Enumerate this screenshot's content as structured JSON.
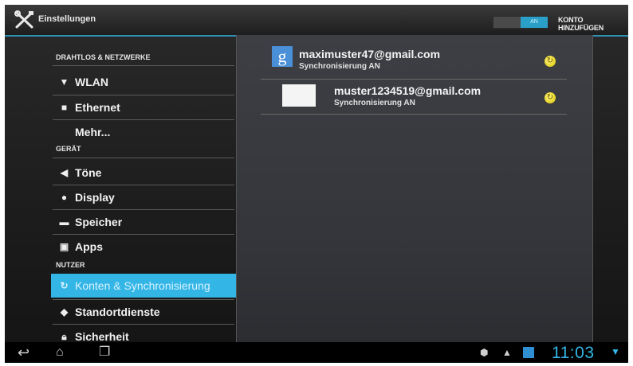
{
  "action_bar": {
    "title": "Einstellungen",
    "toggle_label": "AN",
    "add_account": "KONTO HINZUFÜGEN",
    "icon": "settings-tools-icon"
  },
  "sidebar": {
    "sections": [
      {
        "label": "DRAHTLOS & NETZWERKE"
      },
      {
        "label": "GERÄT"
      },
      {
        "label": "NUTZER"
      }
    ],
    "items": [
      {
        "label": "WLAN",
        "icon": "wifi-icon"
      },
      {
        "label": "Ethernet",
        "icon": "ethernet-icon"
      },
      {
        "label": "Mehr...",
        "icon": ""
      },
      {
        "label": "Töne",
        "icon": "sound-icon"
      },
      {
        "label": "Display",
        "icon": "display-icon"
      },
      {
        "label": "Speicher",
        "icon": "storage-icon"
      },
      {
        "label": "Apps",
        "icon": "apps-icon"
      },
      {
        "label": "Konten & Synchronisierung",
        "icon": "sync-icon",
        "active": true
      },
      {
        "label": "Standortdienste",
        "icon": "location-icon"
      },
      {
        "label": "Sicherheit",
        "icon": "lock-icon"
      }
    ]
  },
  "accounts": [
    {
      "email": "maximuster47@gmail.com",
      "status": "Synchronisierung AN",
      "icon": "google-icon"
    },
    {
      "email": "muster1234519@gmail.com",
      "status": "Synchronisierung AN",
      "icon": "blank-account-icon"
    }
  ],
  "system_bar": {
    "time": "11:03",
    "nav": [
      "back-icon",
      "home-icon",
      "recent-apps-icon"
    ],
    "status_icons": [
      "notification-icon",
      "warning-icon",
      "app-icon"
    ]
  },
  "colors": {
    "accent": "#33b5e5",
    "sync_ok": "#e6d700",
    "background": "#1c1c1c"
  }
}
